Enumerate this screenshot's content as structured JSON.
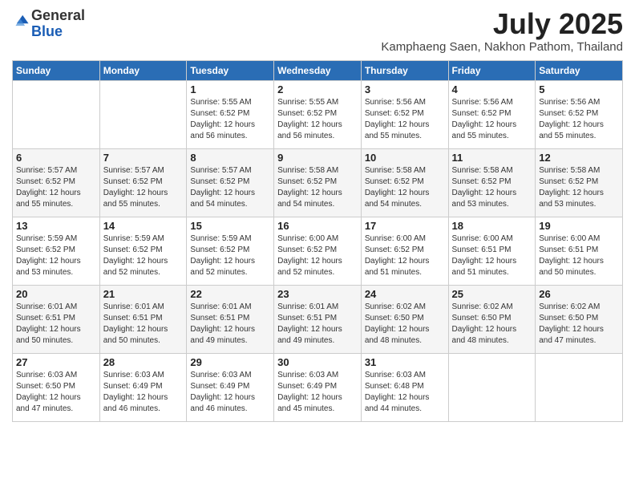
{
  "header": {
    "logo_general": "General",
    "logo_blue": "Blue",
    "month_year": "July 2025",
    "location": "Kamphaeng Saen, Nakhon Pathom, Thailand"
  },
  "calendar": {
    "days_of_week": [
      "Sunday",
      "Monday",
      "Tuesday",
      "Wednesday",
      "Thursday",
      "Friday",
      "Saturday"
    ],
    "weeks": [
      [
        {
          "day": "",
          "detail": ""
        },
        {
          "day": "",
          "detail": ""
        },
        {
          "day": "1",
          "detail": "Sunrise: 5:55 AM\nSunset: 6:52 PM\nDaylight: 12 hours\nand 56 minutes."
        },
        {
          "day": "2",
          "detail": "Sunrise: 5:55 AM\nSunset: 6:52 PM\nDaylight: 12 hours\nand 56 minutes."
        },
        {
          "day": "3",
          "detail": "Sunrise: 5:56 AM\nSunset: 6:52 PM\nDaylight: 12 hours\nand 55 minutes."
        },
        {
          "day": "4",
          "detail": "Sunrise: 5:56 AM\nSunset: 6:52 PM\nDaylight: 12 hours\nand 55 minutes."
        },
        {
          "day": "5",
          "detail": "Sunrise: 5:56 AM\nSunset: 6:52 PM\nDaylight: 12 hours\nand 55 minutes."
        }
      ],
      [
        {
          "day": "6",
          "detail": "Sunrise: 5:57 AM\nSunset: 6:52 PM\nDaylight: 12 hours\nand 55 minutes."
        },
        {
          "day": "7",
          "detail": "Sunrise: 5:57 AM\nSunset: 6:52 PM\nDaylight: 12 hours\nand 55 minutes."
        },
        {
          "day": "8",
          "detail": "Sunrise: 5:57 AM\nSunset: 6:52 PM\nDaylight: 12 hours\nand 54 minutes."
        },
        {
          "day": "9",
          "detail": "Sunrise: 5:58 AM\nSunset: 6:52 PM\nDaylight: 12 hours\nand 54 minutes."
        },
        {
          "day": "10",
          "detail": "Sunrise: 5:58 AM\nSunset: 6:52 PM\nDaylight: 12 hours\nand 54 minutes."
        },
        {
          "day": "11",
          "detail": "Sunrise: 5:58 AM\nSunset: 6:52 PM\nDaylight: 12 hours\nand 53 minutes."
        },
        {
          "day": "12",
          "detail": "Sunrise: 5:58 AM\nSunset: 6:52 PM\nDaylight: 12 hours\nand 53 minutes."
        }
      ],
      [
        {
          "day": "13",
          "detail": "Sunrise: 5:59 AM\nSunset: 6:52 PM\nDaylight: 12 hours\nand 53 minutes."
        },
        {
          "day": "14",
          "detail": "Sunrise: 5:59 AM\nSunset: 6:52 PM\nDaylight: 12 hours\nand 52 minutes."
        },
        {
          "day": "15",
          "detail": "Sunrise: 5:59 AM\nSunset: 6:52 PM\nDaylight: 12 hours\nand 52 minutes."
        },
        {
          "day": "16",
          "detail": "Sunrise: 6:00 AM\nSunset: 6:52 PM\nDaylight: 12 hours\nand 52 minutes."
        },
        {
          "day": "17",
          "detail": "Sunrise: 6:00 AM\nSunset: 6:52 PM\nDaylight: 12 hours\nand 51 minutes."
        },
        {
          "day": "18",
          "detail": "Sunrise: 6:00 AM\nSunset: 6:51 PM\nDaylight: 12 hours\nand 51 minutes."
        },
        {
          "day": "19",
          "detail": "Sunrise: 6:00 AM\nSunset: 6:51 PM\nDaylight: 12 hours\nand 50 minutes."
        }
      ],
      [
        {
          "day": "20",
          "detail": "Sunrise: 6:01 AM\nSunset: 6:51 PM\nDaylight: 12 hours\nand 50 minutes."
        },
        {
          "day": "21",
          "detail": "Sunrise: 6:01 AM\nSunset: 6:51 PM\nDaylight: 12 hours\nand 50 minutes."
        },
        {
          "day": "22",
          "detail": "Sunrise: 6:01 AM\nSunset: 6:51 PM\nDaylight: 12 hours\nand 49 minutes."
        },
        {
          "day": "23",
          "detail": "Sunrise: 6:01 AM\nSunset: 6:51 PM\nDaylight: 12 hours\nand 49 minutes."
        },
        {
          "day": "24",
          "detail": "Sunrise: 6:02 AM\nSunset: 6:50 PM\nDaylight: 12 hours\nand 48 minutes."
        },
        {
          "day": "25",
          "detail": "Sunrise: 6:02 AM\nSunset: 6:50 PM\nDaylight: 12 hours\nand 48 minutes."
        },
        {
          "day": "26",
          "detail": "Sunrise: 6:02 AM\nSunset: 6:50 PM\nDaylight: 12 hours\nand 47 minutes."
        }
      ],
      [
        {
          "day": "27",
          "detail": "Sunrise: 6:03 AM\nSunset: 6:50 PM\nDaylight: 12 hours\nand 47 minutes."
        },
        {
          "day": "28",
          "detail": "Sunrise: 6:03 AM\nSunset: 6:49 PM\nDaylight: 12 hours\nand 46 minutes."
        },
        {
          "day": "29",
          "detail": "Sunrise: 6:03 AM\nSunset: 6:49 PM\nDaylight: 12 hours\nand 46 minutes."
        },
        {
          "day": "30",
          "detail": "Sunrise: 6:03 AM\nSunset: 6:49 PM\nDaylight: 12 hours\nand 45 minutes."
        },
        {
          "day": "31",
          "detail": "Sunrise: 6:03 AM\nSunset: 6:48 PM\nDaylight: 12 hours\nand 44 minutes."
        },
        {
          "day": "",
          "detail": ""
        },
        {
          "day": "",
          "detail": ""
        }
      ]
    ]
  }
}
